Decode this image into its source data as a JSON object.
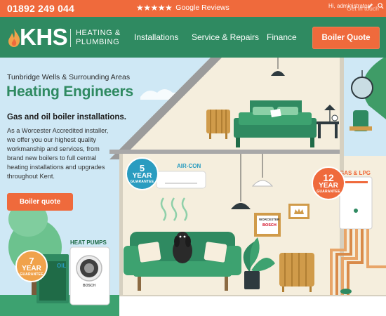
{
  "topbar": {
    "phone": "01892 249 044",
    "stars": "★★★★★",
    "reviews_label": "Google Reviews",
    "admin": "Hi, administrator",
    "contact": "Get in touch",
    "bg": "#ef6a3c"
  },
  "header": {
    "logo_letters": "KHS",
    "logo_line1": "HEATING &",
    "logo_line2": "PLUMBING",
    "nav": [
      "Installations",
      "Service & Repairs",
      "Finance"
    ],
    "cta": "Boiler Quote",
    "bg": "#2f8a61",
    "accent": "#ef6a3c"
  },
  "hero": {
    "subtitle": "Tunbridge Wells & Surrounding Areas",
    "title": "Heating Engineers",
    "heading": "Gas and oil boiler installations.",
    "body": "As a Worcester Accredited installer, we offer you our highest quality workmanship and services, from brand new boilers to full central heating installations and upgrades throughout Kent.",
    "button": "Boiler quote"
  },
  "scene": {
    "air_con_label": "AIR-CON",
    "gas_lpg_label": "GAS & LPG",
    "heat_pumps_label": "HEAT PUMPS",
    "oil_label": "OIL",
    "badge_5": {
      "num": "5",
      "yr": "YEAR",
      "gt": "GUARANTEE"
    },
    "badge_12": {
      "num": "12",
      "yr": "YEAR",
      "gt": "GUARANTEE"
    },
    "badge_7": {
      "num": "7",
      "yr": "YEAR",
      "gt": "GUARANTEE"
    },
    "worcester_text": "WORCESTER",
    "bosch_text": "BOSCH",
    "heatpump_brand": "BOSCH"
  }
}
